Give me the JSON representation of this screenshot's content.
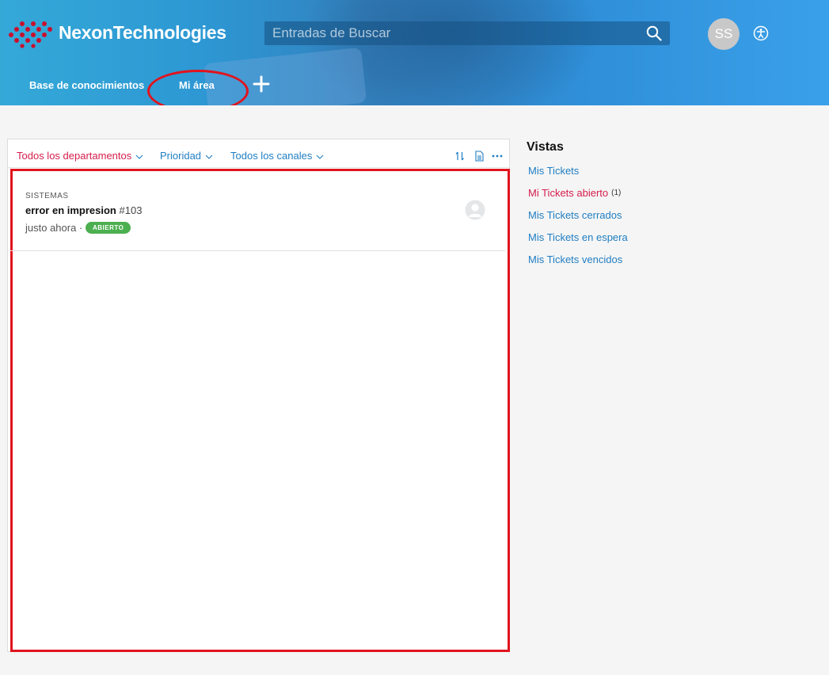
{
  "header": {
    "brand": "NexonTechnologies",
    "search_placeholder": "Entradas de Buscar",
    "avatar_initials": "SS",
    "nav": {
      "knowledge_base": "Base de conocimientos",
      "my_area": "Mi área"
    },
    "colors": {
      "accent_ring": "#e0141e",
      "logo": "#c8102e"
    }
  },
  "toolbar": {
    "filters": [
      {
        "label": "Todos los departamentos",
        "color": "#d51d4d"
      },
      {
        "label": "Prioridad",
        "color": "#1f7ec3"
      },
      {
        "label": "Todos los canales",
        "color": "#1f7ec3"
      }
    ]
  },
  "tickets": [
    {
      "department": "SISTEMAS",
      "title": "error en impresion",
      "number": "#103",
      "time": "justo ahora ·",
      "status": "ABIERTO",
      "status_color": "#4caf50"
    }
  ],
  "views": {
    "title": "Vistas",
    "items": [
      {
        "label": "Mis Tickets",
        "active": false,
        "count": ""
      },
      {
        "label": "Mi Tickets abierto",
        "active": true,
        "count": "(1)"
      },
      {
        "label": "Mis Tickets cerrados",
        "active": false,
        "count": ""
      },
      {
        "label": "Mis Tickets en espera",
        "active": false,
        "count": ""
      },
      {
        "label": "Mis Tickets vencidos",
        "active": false,
        "count": ""
      }
    ]
  }
}
